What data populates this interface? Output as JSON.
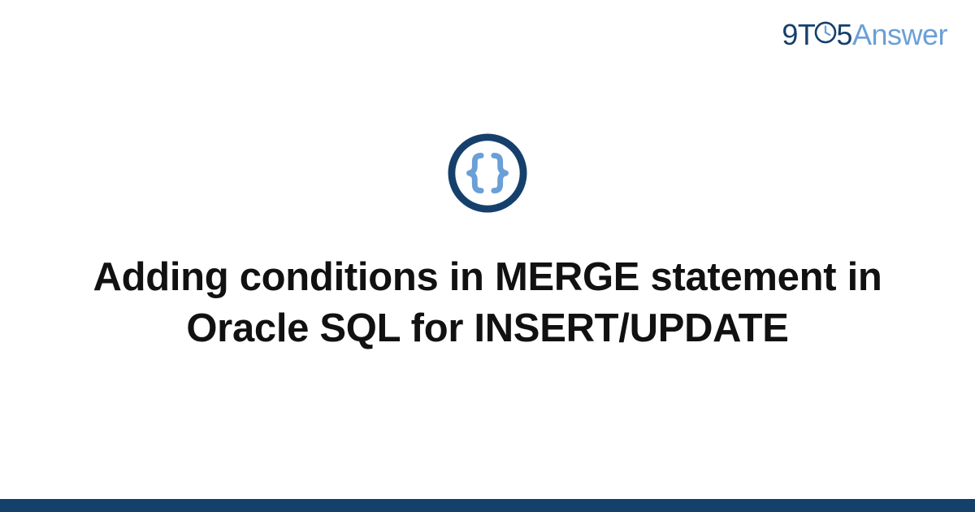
{
  "brand": {
    "nine": "9",
    "t": "T",
    "five": "5",
    "answer": "Answer"
  },
  "logo": {
    "name": "curly-braces-icon",
    "ring_color": "#15406c",
    "brace_color": "#6a9fd8"
  },
  "title": "Adding conditions in MERGE statement in Oracle SQL for INSERT/UPDATE",
  "colors": {
    "brand_dark": "#15406c",
    "brand_light": "#6a9fd8",
    "footer": "#15406c"
  }
}
